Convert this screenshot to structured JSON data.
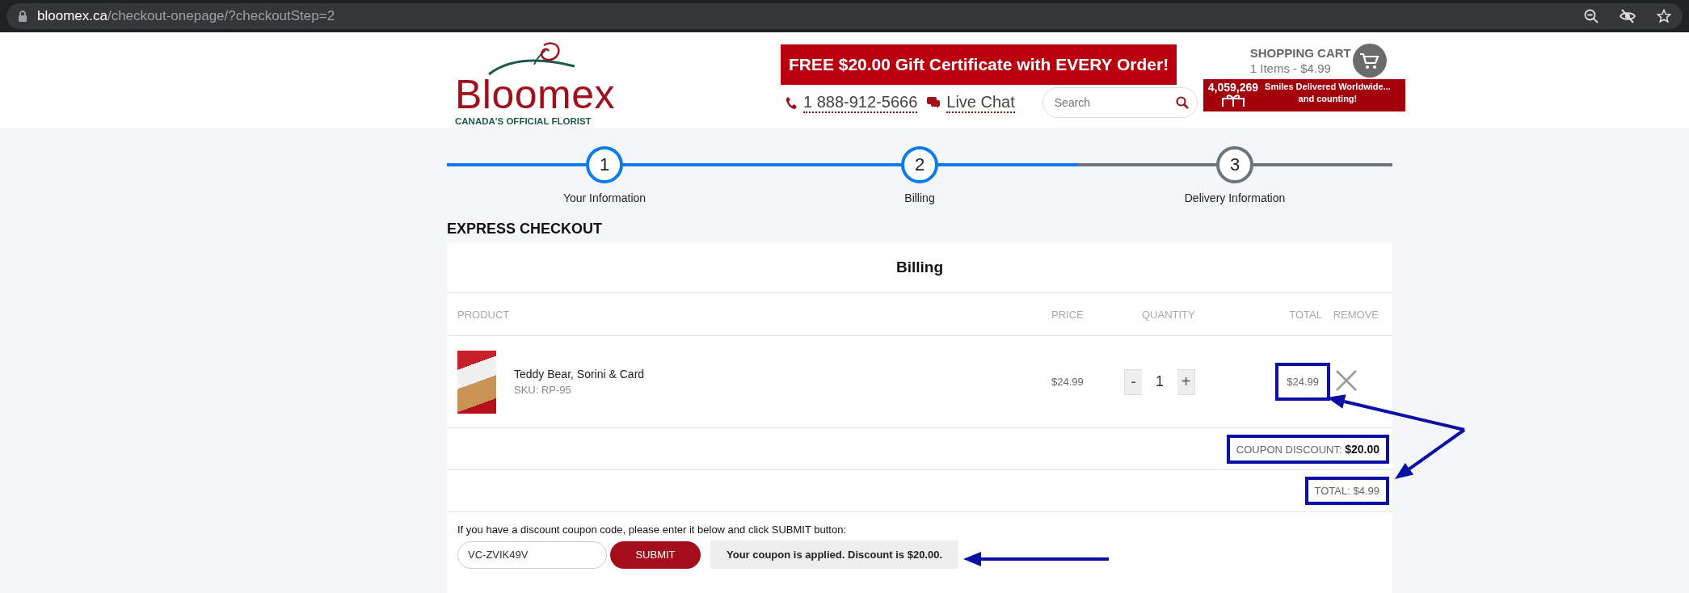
{
  "browser": {
    "url_host": "bloomex.ca",
    "url_path": "/checkout-onepage/?checkoutStep=2"
  },
  "header": {
    "logo": {
      "name": "Bloomex",
      "tagline": "CANADA'S OFFICIAL FLORIST"
    },
    "promo_banner": "FREE $20.00 Gift Certificate with EVERY Order!",
    "phone": "1 888-912-5666",
    "live_chat": "Live Chat",
    "search": {
      "placeholder": "Search"
    },
    "cart": {
      "title": "SHOPPING CART",
      "summary": "1 Items - $4.99"
    },
    "smiles_banner": {
      "count": "4,059,269",
      "line_1": "Smiles Delivered Worldwide...",
      "line_2": "and counting!"
    }
  },
  "steps": [
    {
      "number": "1",
      "label": "Your Information",
      "active": true
    },
    {
      "number": "2",
      "label": "Billing",
      "active": true
    },
    {
      "number": "3",
      "label": "Delivery Information",
      "active": false
    }
  ],
  "section_title": "EXPRESS CHECKOUT",
  "card": {
    "title": "Billing",
    "columns": [
      "PRODUCT",
      "PRICE",
      "QUANTITY",
      "TOTAL",
      "REMOVE"
    ],
    "items": [
      {
        "name": "Teddy Bear, Sorini & Card",
        "sku": "SKU: RP-95",
        "price": "$24.99",
        "decrease": "-",
        "quantity": "1",
        "increase": "+",
        "total": "$24.99",
        "highlighted": true
      }
    ],
    "coupon_discount": {
      "text": "COUPON DISCOUNT: **$20.00**",
      "highlighted": true
    },
    "total": {
      "text": "TOTAL: $4.99",
      "highlighted": true
    },
    "coupon": {
      "instructions": "If you have a discount coupon code, please enter it below and click SUBMIT button:",
      "code": "VC-ZVIK49V",
      "submit": "SUBMIT",
      "message": "Your coupon is applied. Discount is $20.00."
    }
  }
}
